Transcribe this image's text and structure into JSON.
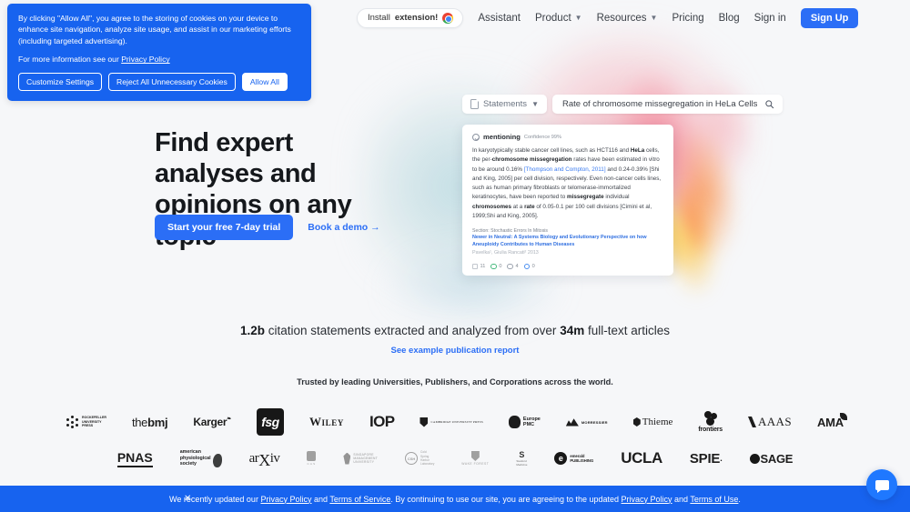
{
  "nav": {
    "search_icon": "search-icon",
    "extension_pill": {
      "prefix": "Install ",
      "bold": "extension!",
      "icon": "chrome-icon"
    },
    "links": [
      {
        "label": "Assistant",
        "has_caret": false
      },
      {
        "label": "Product",
        "has_caret": true
      },
      {
        "label": "Resources",
        "has_caret": true
      },
      {
        "label": "Pricing",
        "has_caret": false
      },
      {
        "label": "Blog",
        "has_caret": false
      },
      {
        "label": "Sign in",
        "has_caret": false
      }
    ],
    "signup_label": "Sign Up"
  },
  "cookie_banner": {
    "body": "By clicking \"Allow All\", you agree to the storing of cookies on your device to enhance site navigation, analyze site usage, and assist in our marketing efforts (including targeted advertising).",
    "more_prefix": "For more information see our ",
    "more_link": "Privacy Policy",
    "buttons": {
      "customize": "Customize Settings",
      "reject": "Reject All Unnecessary Cookies",
      "allow": "Allow All"
    }
  },
  "hero": {
    "title": "Find expert analyses and opinions on any topic",
    "primary_cta": "Start your free 7-day trial",
    "secondary_cta": "Book a demo →"
  },
  "product_card": {
    "filter_label": "Statements",
    "filter_icon": "document-icon",
    "filter_caret": "chevron-down-icon",
    "search_query": "Rate of chromosome missegregation in HeLa Cells",
    "search_icon": "search-icon",
    "statement": {
      "badge": "mentioning",
      "confidence": "Confidence 99%",
      "text_parts": [
        {
          "t": "In karyotypically stable cancer cell lines, such as HCT116 and ",
          "s": "normal"
        },
        {
          "t": "HeLa",
          "s": "bold"
        },
        {
          "t": " cells, the per-",
          "s": "normal"
        },
        {
          "t": "chromosome missegregation",
          "s": "bold"
        },
        {
          "t": " rates have been estimated in vitro to be around 0.16% ",
          "s": "normal"
        },
        {
          "t": "[Thompson and Compton, 2011]",
          "s": "cite"
        },
        {
          "t": " and 0.24-0.39% [Shi and King, 2005] per cell division, respectively. Even non-cancer cells lines, such as human primary fibroblasts or telomerase-immortalized keratinocytes, have been reported to ",
          "s": "normal"
        },
        {
          "t": "missegregate",
          "s": "bold"
        },
        {
          "t": " individual ",
          "s": "normal"
        },
        {
          "t": "chromosomes",
          "s": "bold"
        },
        {
          "t": " at a ",
          "s": "normal"
        },
        {
          "t": "rate",
          "s": "bold"
        },
        {
          "t": " of 0.05-0.1 per 100 cell divisions [Cimini et al, 1999;Shi and King, 2005].",
          "s": "normal"
        }
      ],
      "section": "Section: Stochastic Errors In Mitosis",
      "paper_title": "Newer in Neutral: A Systems Biology and Evolutionary Perspective on how Aneuploidy Contributes to Human Diseases",
      "authors": "Pavelka¹, Giulia Rancati² 2013",
      "stats": [
        {
          "icon": "citation-icon",
          "value": "11"
        },
        {
          "icon": "supporting-icon",
          "value": "0"
        },
        {
          "icon": "contrasting-icon",
          "value": "4"
        },
        {
          "icon": "mentioning-icon",
          "value": "0"
        }
      ]
    }
  },
  "stats_band": {
    "number_1": "1.2b",
    "mid_text": " citation statements extracted and analyzed from over ",
    "number_2": "34m",
    "end_text": " full-text articles",
    "report_link": "See example publication report",
    "trusted_text": "Trusted by leading Universities, Publishers, and Corporations across the world."
  },
  "logos": {
    "row1": [
      {
        "name": "rockefeller-university-press",
        "line1": "Rockefeller",
        "line2": "University",
        "line3": "Press"
      },
      {
        "name": "the-bmj",
        "plain": "the",
        "bold": "bmj"
      },
      {
        "name": "karger",
        "text": "Karger"
      },
      {
        "name": "fsg",
        "text": "fsg"
      },
      {
        "name": "wiley",
        "text": "Wiley"
      },
      {
        "name": "iop-publishing",
        "text": "IOP"
      },
      {
        "name": "cambridge-university-press",
        "text": "Cambridge University Press"
      },
      {
        "name": "europe-pmc",
        "line1": "Europe",
        "line2": "PMC"
      },
      {
        "name": "morressier",
        "text": "MORRESSIER"
      },
      {
        "name": "thieme",
        "text": "Thieme"
      },
      {
        "name": "frontiers",
        "text": "frontiers"
      },
      {
        "name": "aaas",
        "text": "AAAS"
      },
      {
        "name": "ama",
        "text": "AMA"
      }
    ],
    "row2": [
      {
        "name": "pnas",
        "text": "PNAS"
      },
      {
        "name": "american-physiological-society",
        "line1": "american",
        "line2": "physiological",
        "line3": "society"
      },
      {
        "name": "arxiv",
        "pre": "ar",
        "x": "X",
        "post": "iv"
      },
      {
        "name": "chinese-academy-of-sciences",
        "text": "CAS"
      },
      {
        "name": "singapore-management-university",
        "line1": "Singapore",
        "line2": "Management",
        "line3": "University"
      },
      {
        "name": "cold-spring-harbor-laboratory",
        "mark": "CSH",
        "line1": "Cold",
        "line2": "Spring",
        "line3": "Harbor",
        "line4": "Laboratory"
      },
      {
        "name": "wake-forest-university",
        "text": "Wake Forest"
      },
      {
        "name": "stanford-medicine",
        "mark": "S",
        "line1": "Stanford",
        "line2": "Medicine"
      },
      {
        "name": "emerald-publishing",
        "mark": "e",
        "line1": "emerald",
        "line2": "PUBLISHING"
      },
      {
        "name": "ucla",
        "text": "UCLA"
      },
      {
        "name": "spie",
        "text": "SPIE"
      },
      {
        "name": "sage",
        "text": "SAGE"
      }
    ]
  },
  "bottom_bar": {
    "close_icon": "close-icon",
    "part1": "We recently updated our ",
    "link1": "Privacy Policy",
    "part2": " and ",
    "link2": "Terms of Service",
    "part3": ". By continuing to use our site, you are agreeing to the updated ",
    "link3": "Privacy Policy",
    "part4": " and ",
    "link4": "Terms of Use",
    "part5": "."
  },
  "chat": {
    "icon": "chat-bubble-icon"
  },
  "colors": {
    "brand_blue": "#2b6ef6",
    "banner_blue": "#1763ef",
    "page_bg": "#f6f7f9",
    "cite_blue": "#3a7bf0"
  }
}
